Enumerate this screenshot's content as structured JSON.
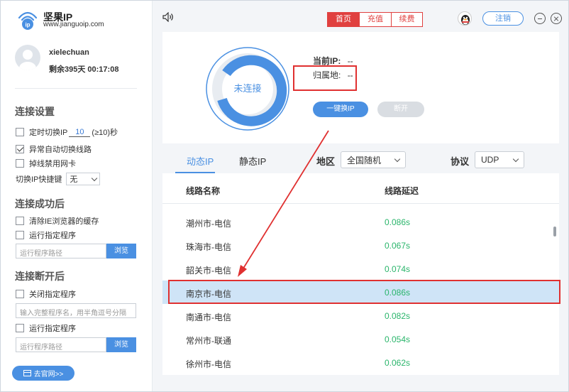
{
  "brand": {
    "name": "坚果IP",
    "url": "www.jianguoip.com"
  },
  "user": {
    "name": "xielechuan",
    "remaining": "剩余395天 00:17:08"
  },
  "sidebar": {
    "section1": {
      "title": "连接设置",
      "timer_prefix": "定时切换IP",
      "timer_value": "10",
      "timer_suffix": "(≥10)秒",
      "auto_switch": "异常自动切换线路",
      "disable_nic": "掉线禁用网卡",
      "hotkey_label": "切换IP快捷键",
      "hotkey_value": "无"
    },
    "section2": {
      "title": "连接成功后",
      "clear_cache": "清除IE浏览器的缓存",
      "run_program": "运行指定程序",
      "path_placeholder": "运行程序路径",
      "browse": "浏览"
    },
    "section3": {
      "title": "连接断开后",
      "close_program": "关闭指定程序",
      "program_placeholder": "输入完整程序名，用半角逗号分隔",
      "run_program": "运行指定程序",
      "path_placeholder": "运行程序路径",
      "browse": "浏览"
    },
    "site_button": "去官网>>"
  },
  "topbar": {
    "tabs": [
      "首页",
      "充值",
      "续费"
    ],
    "logout": "注销"
  },
  "status": {
    "ring_label": "未连接",
    "current_ip_label": "当前IP:",
    "current_ip_value": "--",
    "location_label": "归属地:",
    "location_value": "--",
    "switch_button": "一键换IP",
    "disconnect_button": "断开"
  },
  "filters": {
    "tab_dynamic": "动态IP",
    "tab_static": "静态IP",
    "region_label": "地区",
    "region_value": "全国随机",
    "protocol_label": "协议",
    "protocol_value": "UDP"
  },
  "list": {
    "col_name": "线路名称",
    "col_latency": "线路延迟",
    "rows": [
      {
        "name": "潮州市-电信",
        "latency": "0.086s"
      },
      {
        "name": "珠海市-电信",
        "latency": "0.067s"
      },
      {
        "name": "韶关市-电信",
        "latency": "0.074s"
      },
      {
        "name": "南京市-电信",
        "latency": "0.086s"
      },
      {
        "name": "南通市-电信",
        "latency": "0.082s"
      },
      {
        "name": "常州市-联通",
        "latency": "0.054s"
      },
      {
        "name": "徐州市-电信",
        "latency": "0.062s"
      }
    ]
  },
  "colors": {
    "accent": "#4a90e2",
    "red": "#e0403f",
    "green": "#2ab56b",
    "selected_row": "#cfe4f7"
  }
}
